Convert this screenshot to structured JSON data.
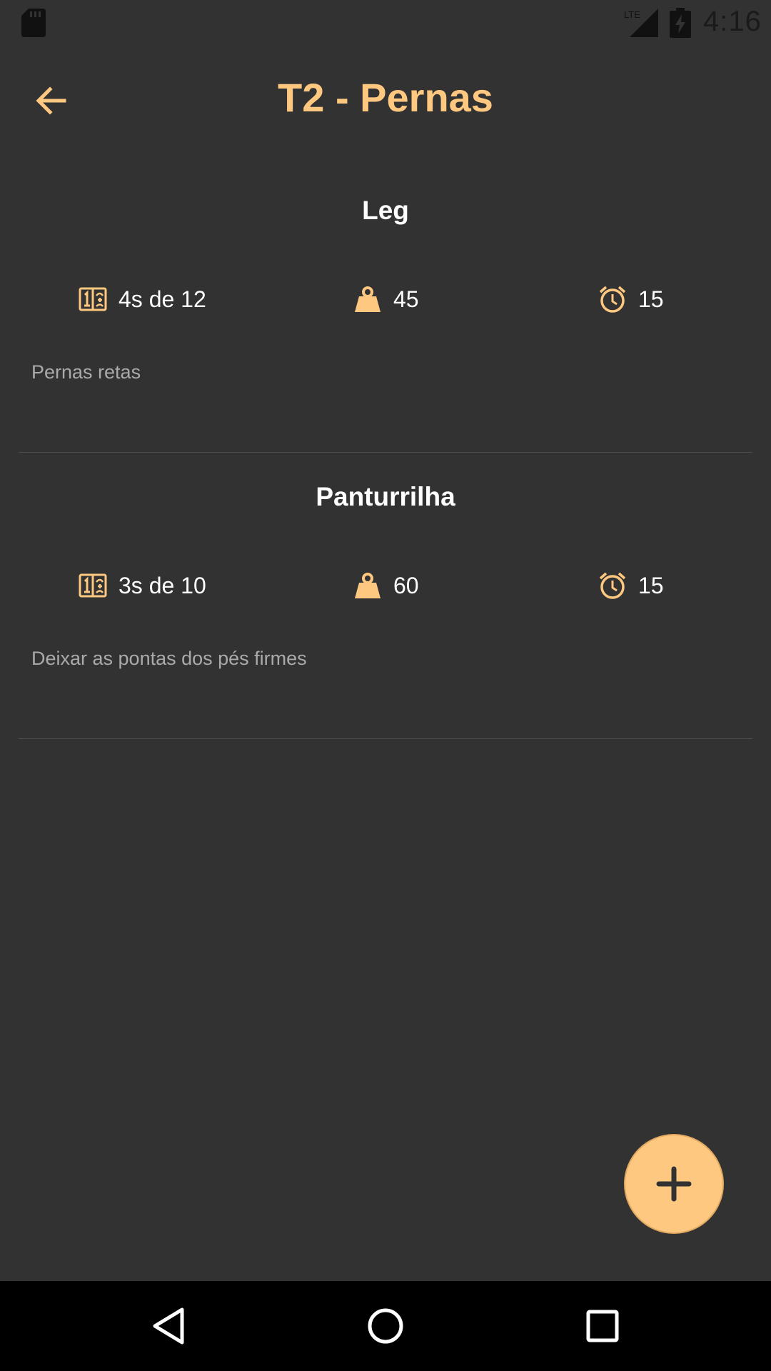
{
  "status_bar": {
    "time": "4:16",
    "network": "LTE",
    "icons": [
      "sd-card-icon",
      "lte-signal-icon",
      "battery-charging-icon"
    ]
  },
  "header": {
    "title": "T2 - Pernas",
    "back_icon": "arrow-back-icon"
  },
  "exercises": [
    {
      "name": "Leg",
      "sets": "4s de 12",
      "weight": "45",
      "rest": "15",
      "note": "Pernas retas"
    },
    {
      "name": "Panturrilha",
      "sets": "3s de 10",
      "weight": "60",
      "rest": "15",
      "note": "Deixar as pontas dos pés firmes"
    }
  ],
  "fab": {
    "icon": "plus-icon"
  },
  "nav_bar": {
    "icons": [
      "nav-back-icon",
      "nav-home-icon",
      "nav-recents-icon"
    ]
  },
  "colors": {
    "background": "#323232",
    "accent": "#ffc880",
    "text_primary": "#ffffff",
    "text_secondary": "#aaaaaa",
    "divider": "#4d4d4d",
    "nav_bar": "#000000"
  }
}
